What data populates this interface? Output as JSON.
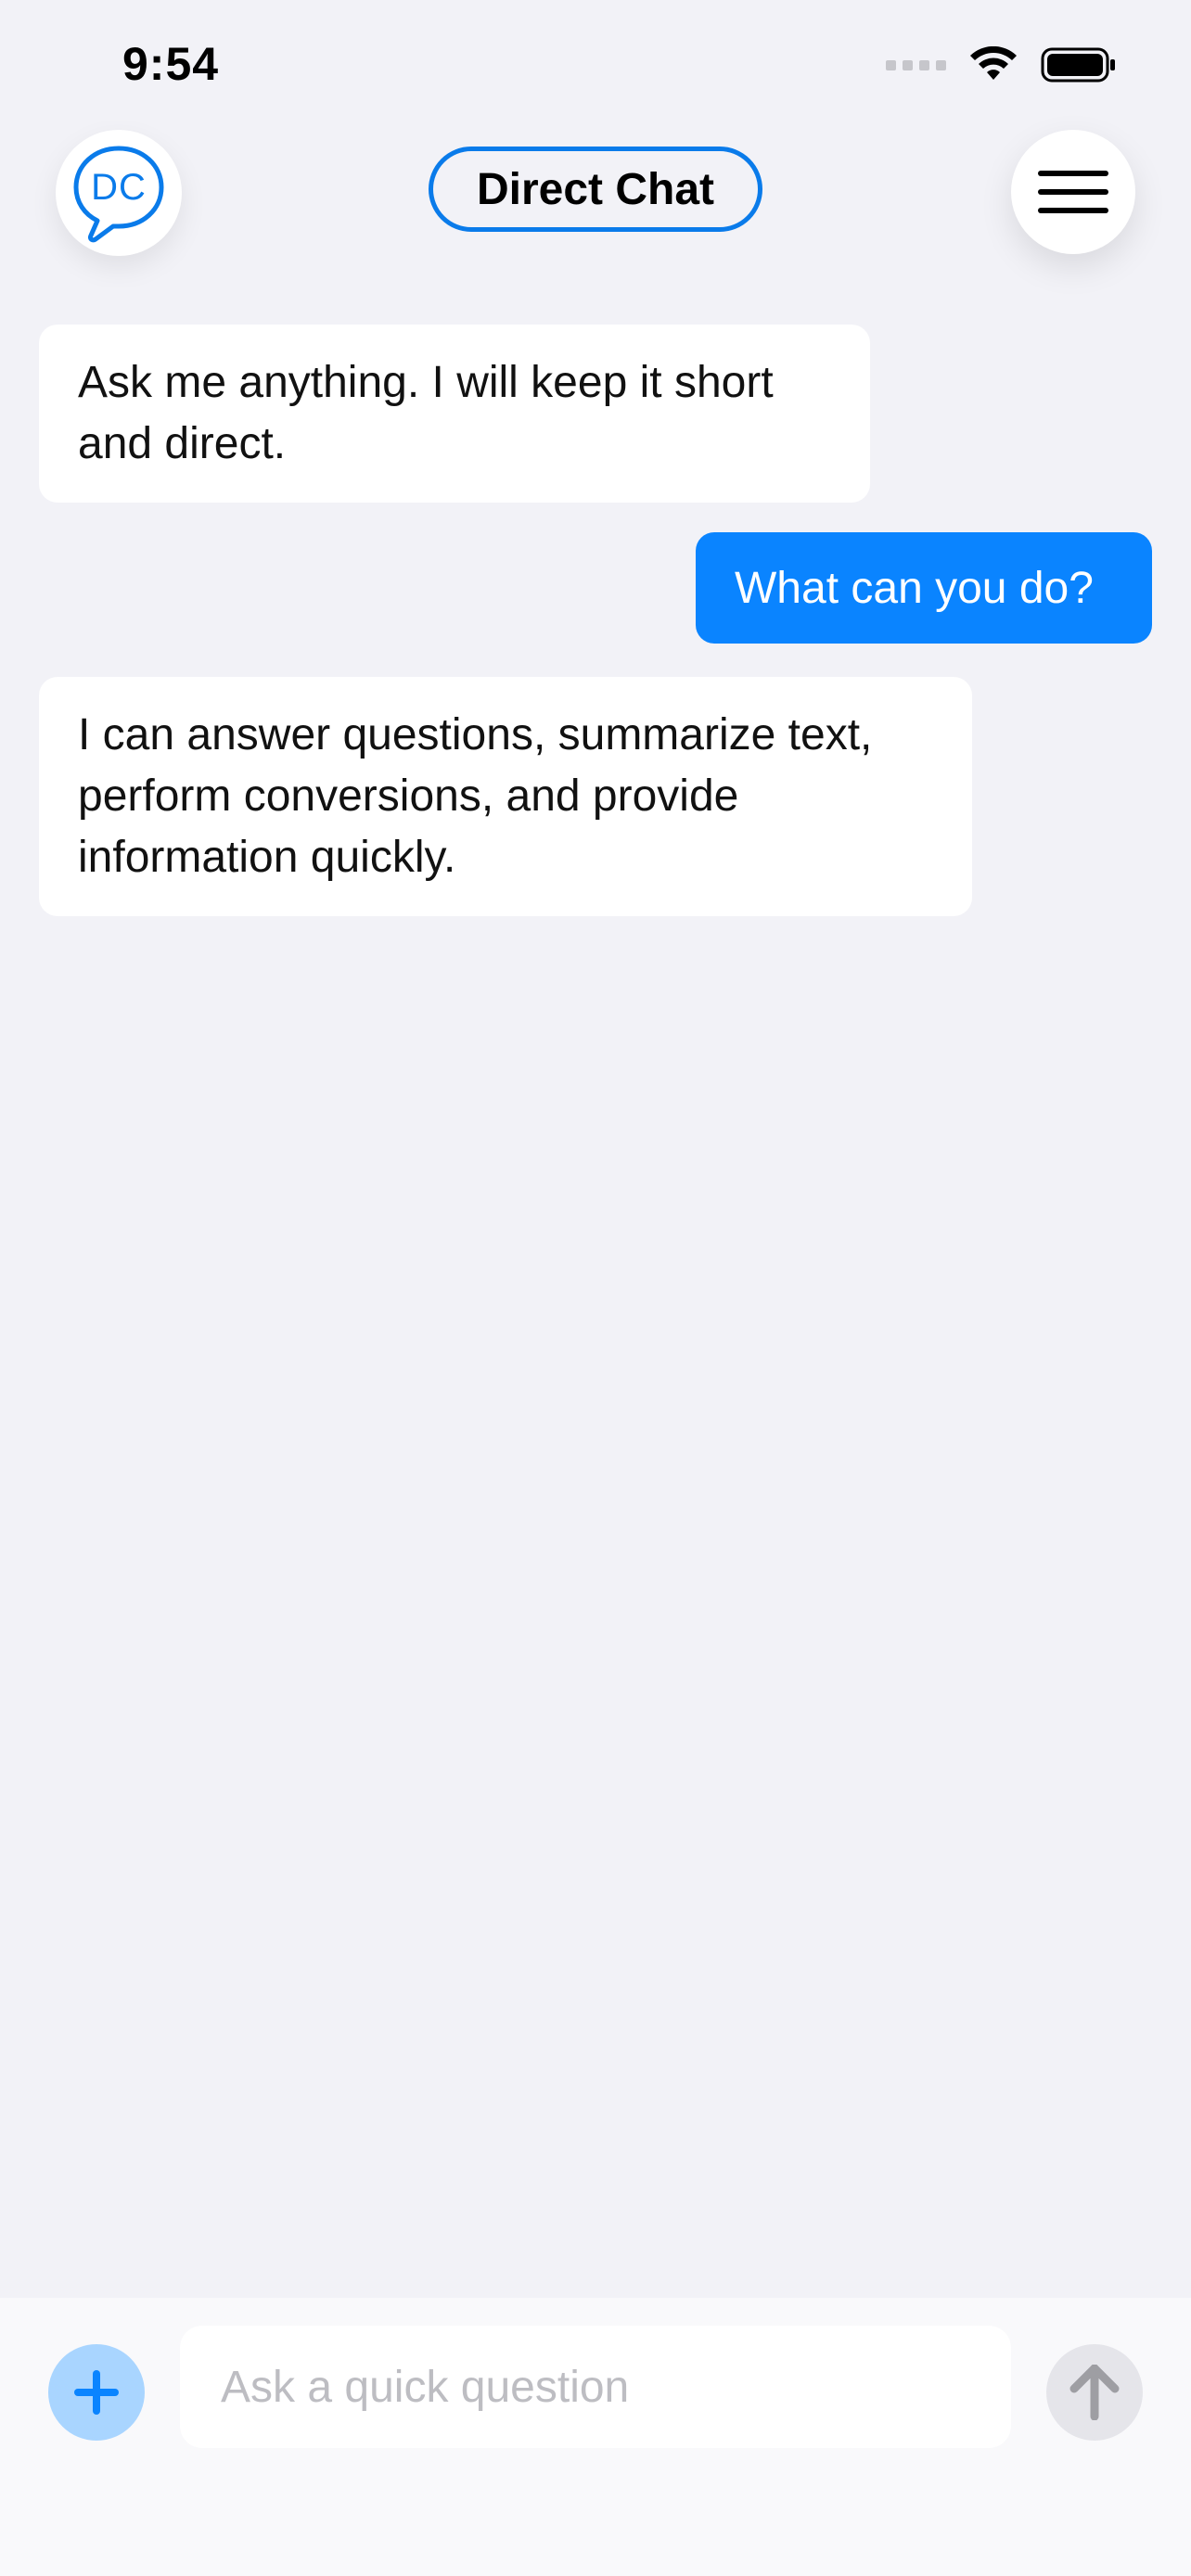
{
  "status_bar": {
    "time": "9:54"
  },
  "header": {
    "avatar_text": "DC",
    "title": "Direct Chat",
    "menu_icon": "hamburger-menu-icon"
  },
  "messages": [
    {
      "role": "bot",
      "text": "Ask me anything. I will keep it short and direct."
    },
    {
      "role": "user",
      "text": "What can you do?"
    },
    {
      "role": "bot",
      "text": "I can answer questions, summarize text, perform conversions, and provide information quickly."
    }
  ],
  "composer": {
    "placeholder": "Ask a quick question",
    "value": "",
    "plus_icon": "plus-icon",
    "send_icon": "arrow-up-icon"
  },
  "colors": {
    "accent": "#0A84FF",
    "background": "#F2F2F7"
  }
}
